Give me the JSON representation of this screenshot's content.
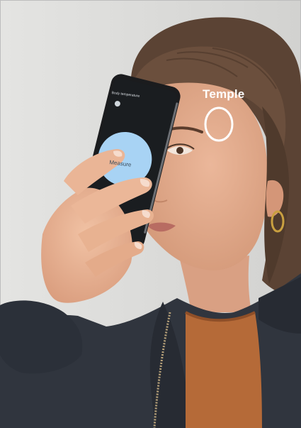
{
  "callout": {
    "label": "Temple",
    "color": "#ffffff"
  },
  "phone_screen": {
    "title": "Body temperature",
    "button_label": "Measure",
    "button_color": "#a8d3f4",
    "screen_color": "#1a1d20"
  },
  "palette": {
    "background": "#dadad8",
    "skin": "#e3ab8e",
    "hair": "#5a4233",
    "jacket": "#2f343d",
    "shirt": "#b86a37"
  }
}
